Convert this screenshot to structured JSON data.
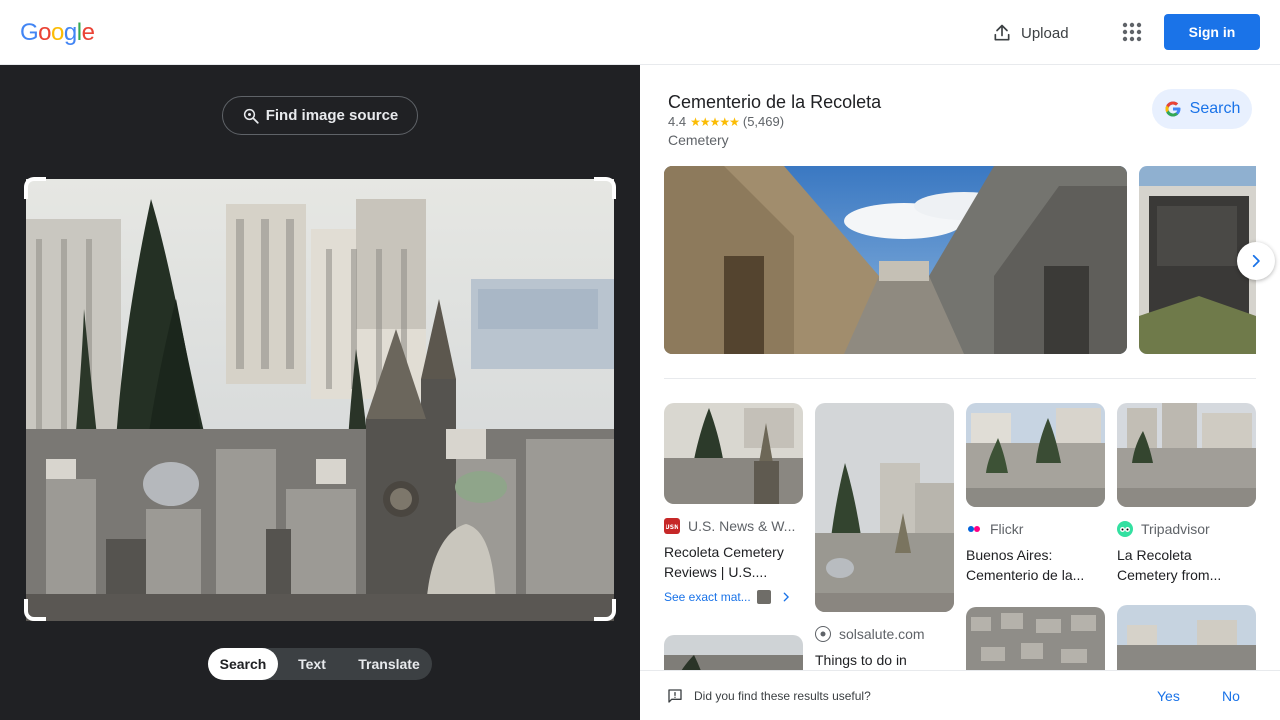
{
  "header": {
    "logo": "Google",
    "upload_label": "Upload",
    "signin_label": "Sign in"
  },
  "left": {
    "find_source_label": "Find image source",
    "modes": [
      "Search",
      "Text",
      "Translate"
    ],
    "active_mode": "Search"
  },
  "knowledge": {
    "title": "Cementerio de la Recoleta",
    "rating": "4.4",
    "stars": 4.4,
    "reviews": "(5,469)",
    "type": "Cemetery",
    "search_label": "Search"
  },
  "results": [
    {
      "source": "U.S. News & W...",
      "title": "Recoleta Cemetery Reviews | U.S....",
      "exact": "See exact mat..."
    },
    {
      "source": "solsalute.com",
      "title": "Things to do in"
    },
    {
      "source": "Flickr",
      "title": "Buenos Aires: Cementerio de la..."
    },
    {
      "source": "Tripadvisor",
      "title": "La Recoleta Cemetery from..."
    }
  ],
  "feedback": {
    "question": "Did you find these results useful?",
    "yes": "Yes",
    "no": "No"
  },
  "colors": {
    "accent": "#1a73e8",
    "dark_pane": "#202124",
    "star": "#fbbc04"
  }
}
